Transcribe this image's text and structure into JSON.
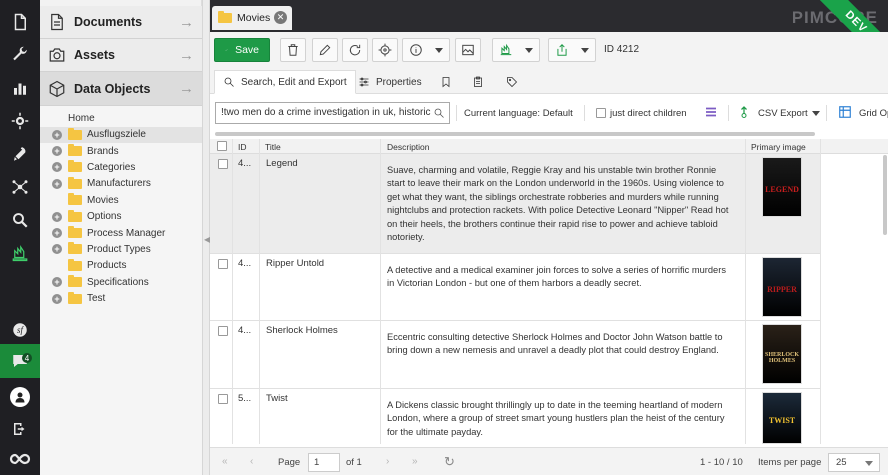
{
  "rail": {
    "items": [
      {
        "name": "file-icon"
      },
      {
        "name": "wrench-icon"
      },
      {
        "name": "bar-chart-icon"
      },
      {
        "name": "gear-icon"
      },
      {
        "name": "marketing-icon"
      },
      {
        "name": "network-icon"
      },
      {
        "name": "search-icon"
      },
      {
        "name": "datahub-icon"
      },
      {
        "name": "symfony-icon"
      },
      {
        "name": "chat-icon"
      },
      {
        "name": "user-icon"
      },
      {
        "name": "logout-icon"
      },
      {
        "name": "pimcore-logo-icon"
      }
    ],
    "chat_badge": "4"
  },
  "accordion": {
    "documents": "Documents",
    "assets": "Assets",
    "data_objects": "Data Objects"
  },
  "tree": {
    "root": "Home",
    "nodes": [
      {
        "label": "Ausflugsziele",
        "expandable": true
      },
      {
        "label": "Brands",
        "expandable": true
      },
      {
        "label": "Categories",
        "expandable": true
      },
      {
        "label": "Manufacturers",
        "expandable": true
      },
      {
        "label": "Movies",
        "expandable": false
      },
      {
        "label": "Options",
        "expandable": true
      },
      {
        "label": "Process Manager",
        "expandable": true
      },
      {
        "label": "Product Types",
        "expandable": true
      },
      {
        "label": "Products",
        "expandable": false
      },
      {
        "label": "Specifications",
        "expandable": true
      },
      {
        "label": "Test",
        "expandable": true
      }
    ]
  },
  "tab": {
    "title": "Movies"
  },
  "brand": {
    "logo_text": "PIMCORE",
    "env_ribbon": "DEV"
  },
  "toolbar": {
    "save_label": "Save",
    "id_label": "ID 4212"
  },
  "subtabs": {
    "search_edit_export": "Search, Edit and Export",
    "properties": "Properties"
  },
  "filter": {
    "search_value": "!two men do a crime investigation in uk, historic",
    "current_language": "Current language: Default",
    "just_direct_children": "just direct children",
    "csv_export": "CSV Export",
    "grid_options": "Grid Op"
  },
  "grid": {
    "columns": [
      "ID",
      "Title",
      "Description",
      "Primary image"
    ],
    "rows": [
      {
        "id": "4...",
        "title": "Legend",
        "description": "Suave, charming and volatile, Reggie Kray and his unstable twin brother Ronnie start to leave their mark on the London underworld in the 1960s. Using violence to get what they want, the siblings orchestrate robberies and murders while running nightclubs and protection rackets. With police Detective Leonard \"Nipper\" Read hot on their heels, the brothers continue their rapid rise to power and achieve tabloid notoriety.",
        "poster_text": "LEGEND",
        "poster_color": "#1a1a1a",
        "poster_accent": "#c81e1e"
      },
      {
        "id": "4...",
        "title": "Ripper Untold",
        "description": "A detective and a medical examiner join forces to solve a series of horrific murders in Victorian London - but one of them harbors a deadly secret.",
        "poster_text": "RIPPER",
        "poster_color": "#1d2633",
        "poster_accent": "#b71c1c"
      },
      {
        "id": "4...",
        "title": "Sherlock Holmes",
        "description": "Eccentric consulting detective Sherlock Holmes and Doctor John Watson battle to bring down a new nemesis and unravel a deadly plot that could destroy England.",
        "poster_text": "SHERLOCK HOLMES",
        "poster_color": "#2a2118",
        "poster_accent": "#e0c27a"
      },
      {
        "id": "5...",
        "title": "Twist",
        "description": "A Dickens classic brought thrillingly up to date in the teeming heartland of modern London, where a group of street smart young hustlers plan the heist of the century for the ultimate payday.",
        "poster_text": "TWIST",
        "poster_color": "#1c2a3a",
        "poster_accent": "#f2c230"
      }
    ]
  },
  "pager": {
    "page_label": "Page",
    "page_value": "1",
    "of_label": "of 1",
    "range": "1 - 10 / 10",
    "items_per_page_label": "Items per page",
    "items_per_page_value": "25"
  }
}
